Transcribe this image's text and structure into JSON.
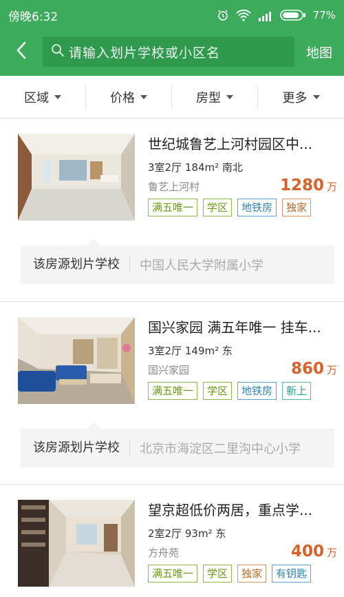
{
  "status_bar": {
    "time": "傍晚6:32",
    "battery": "77%",
    "colors": {
      "header_bg": "#3dab5c",
      "search_bg": "#2f9a4d"
    }
  },
  "header": {
    "back_icon": "back-arrow-icon",
    "search_icon": "search-icon",
    "search_placeholder": "请输入划片学校或小区名",
    "map_label": "地图"
  },
  "filters": [
    {
      "label": "区域"
    },
    {
      "label": "价格"
    },
    {
      "label": "房型"
    },
    {
      "label": "更多"
    }
  ],
  "listings": [
    {
      "title": "世纪城鲁艺上河村园区中...",
      "specs": "3室2厅 184m² 南北",
      "community": "鲁艺上河村",
      "price": "1280",
      "unit": "万",
      "tags": [
        "满五唯一",
        "学区",
        "地铁房",
        "独家"
      ],
      "school_label": "该房源划片学校",
      "school_name": "中国人民大学附属小学"
    },
    {
      "title": "国兴家园 满五年唯一 挂车...",
      "specs": "3室2厅 149m² 东",
      "community": "国兴家园",
      "price": "860",
      "unit": "万",
      "tags": [
        "满五唯一",
        "学区",
        "地铁房",
        "新上"
      ],
      "school_label": "该房源划片学校",
      "school_name": "北京市海淀区二里沟中心小学"
    },
    {
      "title": "望京超低价两居，重点学...",
      "specs": "2室2厅 93m² 东",
      "community": "方舟苑",
      "price": "400",
      "unit": "万",
      "tags": [
        "满五唯一",
        "学区",
        "独家",
        "有钥匙"
      ]
    }
  ],
  "tag_colors": {
    "green": "#6a9a17",
    "blue": "#2e86b3",
    "orange": "#b86a2b",
    "teal": "#2b9a8c",
    "price": "#d9622b"
  }
}
